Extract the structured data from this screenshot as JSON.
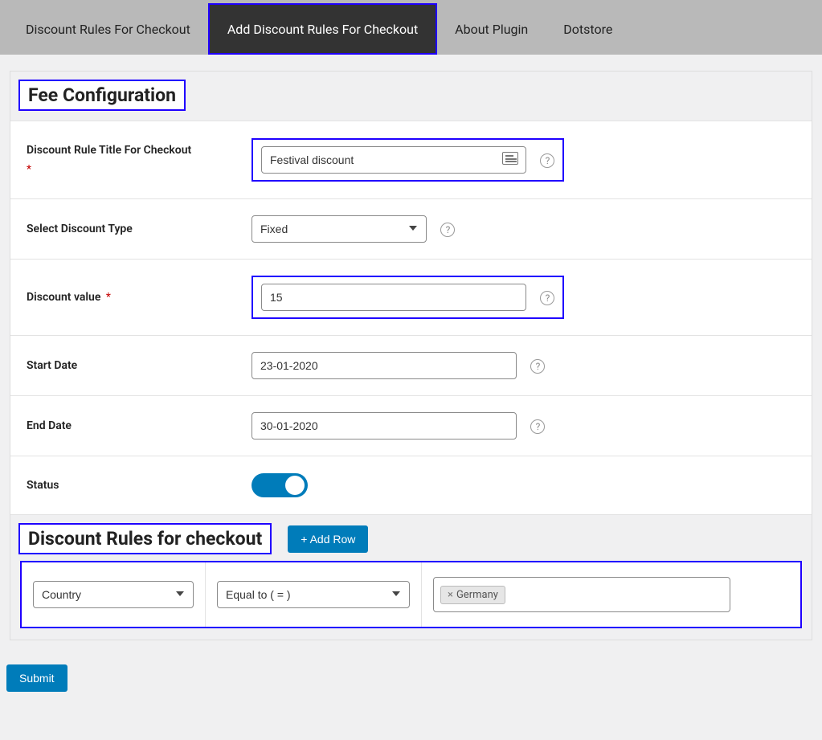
{
  "tabs": {
    "t1": "Discount Rules For Checkout",
    "t2": "Add Discount Rules For Checkout",
    "t3": "About Plugin",
    "t4": "Dotstore"
  },
  "fee": {
    "section_title": "Fee Configuration",
    "title_label": "Discount Rule Title For Checkout",
    "title_value": "Festival discount",
    "type_label": "Select Discount Type",
    "type_value": "Fixed",
    "value_label": "Discount value",
    "value_value": "15",
    "start_label": "Start Date",
    "start_value": "23-01-2020",
    "end_label": "End Date",
    "end_value": "30-01-2020",
    "status_label": "Status",
    "required_mark": "*"
  },
  "rules": {
    "section_title": "Discount Rules for checkout",
    "add_row_label": "+ Add Row",
    "condition_type": "Country",
    "condition_op": "Equal to ( = )",
    "condition_value": "Germany",
    "tag_close": "×"
  },
  "submit_label": "Submit",
  "help_glyph": "?"
}
